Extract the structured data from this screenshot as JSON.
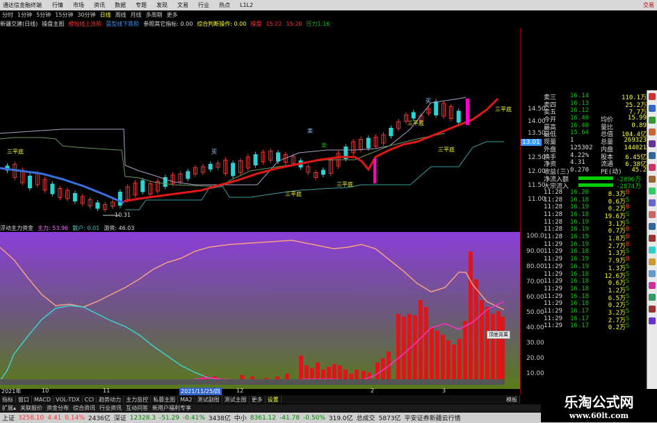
{
  "app": {
    "title": "通达信金融终端",
    "menus": [
      "行情",
      "市场",
      "资讯",
      "数据",
      "专题",
      "发现",
      "文易",
      "行业",
      "热点",
      "L1L2"
    ],
    "trade_label": "交易"
  },
  "periods": [
    "分时",
    "1分钟",
    "5分钟",
    "15分钟",
    "30分钟",
    "日线",
    "周线",
    "月线",
    "多周期",
    "更多"
  ],
  "periods_selected": 5,
  "indicator_line": {
    "main": "新疆交建(日线)",
    "n1": "操盘主图",
    "n2": "橙短线上涨阶",
    "n3": "蓝型线下跌阶",
    "n4": "参照其它指标: 0.00",
    "n5": "综合判断操作: 0.00",
    "n6": "操盘",
    "n7": "15:22",
    "n8": "15:20",
    "n9": "压力1:16"
  },
  "annotations": {
    "a1": "三平底",
    "a2": "三平底",
    "a3": "三平底",
    "a4": "三平底",
    "a5": "三平底",
    "a6": "三平底",
    "low": "10.31",
    "t1": "买",
    "t2": "卖",
    "t3": "买",
    "t4": "卖"
  },
  "yaxis_top": [
    "14.50",
    "14.00",
    "13.50",
    "13.01",
    "12.50",
    "12.00",
    "11.50",
    "11.00"
  ],
  "quote": {
    "rows": [
      {
        "k": "卖三",
        "v": "16.14",
        "r": "110.1万"
      },
      {
        "k": "卖四",
        "v": "16.13",
        "r": "25.2万"
      },
      {
        "k": "卖五",
        "v": "16.12",
        "r": "7.7万"
      },
      {
        "k": "今开",
        "v": "16.40",
        "k2": "均价",
        "r": "15.99"
      },
      {
        "k": "最高",
        "v": "16.40",
        "k2": "量比",
        "r": "0.89"
      },
      {
        "k": "最低",
        "v": "15.64",
        "k2": "总值",
        "r": "104.4亿"
      },
      {
        "k": "现量",
        "v": "1",
        "k2": "总量",
        "r": "269323"
      },
      {
        "k": "外盘",
        "v": "125302",
        "k2": "内盘",
        "r": "144021"
      },
      {
        "k": "换手",
        "v": "4.22%",
        "k2": "股本",
        "r": "6.45亿"
      },
      {
        "k": "净资",
        "v": "4.31",
        "k2": "流通",
        "r": "6.38亿"
      },
      {
        "k": "收益(三)",
        "v": "0.270",
        "k2": "PE(动)",
        "r": "45.2"
      }
    ],
    "flows": [
      {
        "k": "净流入额",
        "r": "-2896万"
      },
      {
        "k": "大宗流入",
        "r": "-2874万"
      }
    ],
    "ticks": [
      {
        "t": "11:28",
        "p": "16.20",
        "v": "8.3万",
        "s": "B"
      },
      {
        "t": "11:28",
        "p": "16.18",
        "v": "0.6万",
        "s": "S"
      },
      {
        "t": "11:28",
        "p": "16.19",
        "v": "0.2万",
        "s": "B"
      },
      {
        "t": "11:28",
        "p": "16.18",
        "v": "19.6万",
        "s": "S"
      },
      {
        "t": "11:28",
        "p": "16.19",
        "v": "3.1万",
        "s": "S"
      },
      {
        "t": "11:28",
        "p": "16.19",
        "v": "0.7万",
        "s": "B"
      },
      {
        "t": "11:28",
        "p": "16.19",
        "v": "1.8万",
        "s": "B"
      },
      {
        "t": "11:29",
        "p": "16.19",
        "v": "2.7万",
        "s": "B"
      },
      {
        "t": "11:29",
        "p": "16.18",
        "v": "1.3万",
        "s": "S"
      },
      {
        "t": "11:29",
        "p": "16.19",
        "v": "7.9万",
        "s": "B"
      },
      {
        "t": "11:29",
        "p": "16.19",
        "v": "1.3万",
        "s": "S"
      },
      {
        "t": "11:29",
        "p": "16.18",
        "v": "12.6万",
        "s": "S"
      },
      {
        "t": "11:29",
        "p": "16.18",
        "v": "0.6万",
        "s": "S"
      },
      {
        "t": "11:29",
        "p": "16.18",
        "v": "1.2万",
        "s": "S"
      },
      {
        "t": "11:29",
        "p": "16.18",
        "v": "6.5万",
        "s": "S"
      },
      {
        "t": "11:29",
        "p": "16.18",
        "v": "0.2万",
        "s": "S"
      },
      {
        "t": "11:29",
        "p": "16.17",
        "v": "3.2万",
        "s": "S"
      },
      {
        "t": "11:29",
        "p": "16.17",
        "v": "2.7万",
        "s": "S"
      },
      {
        "t": "11:29",
        "p": "16.17",
        "v": "0.2万",
        "s": "S"
      }
    ]
  },
  "sub_title": {
    "name": "浮动主力资金",
    "main": "主力: 53.96",
    "retail": "散户: 0.01",
    "swim": "游资: 46.03"
  },
  "yaxis_bot": [
    "100.0",
    "90.00",
    "80.00",
    "70.00",
    "60.00",
    "50.00",
    "40.00",
    "30.00",
    "20.00",
    "10.00"
  ],
  "date_axis": [
    "2021年",
    "10",
    "11",
    "2021/11/25/四",
    "12",
    "2",
    "3"
  ],
  "tooltip": "顶底背离",
  "tabs": [
    "指标",
    "窗口",
    "MACD",
    "VOL-TDX",
    "CCI",
    "趋势动力",
    "主力监控",
    "私募主图",
    "MA2",
    "测试副图",
    "测试主图",
    "更多",
    "设置"
  ],
  "tabs_selected": 12,
  "tabs_right": "模板",
  "tabs2": [
    "扩展▴",
    "关联报价",
    "资金分布",
    "综合资讯",
    "行业资讯",
    "互动问答",
    "新用户福利专享"
  ],
  "status": {
    "sh_label": "上证",
    "sh": "3258.10",
    "sh_chg": "4.41",
    "sh_pct": "0.14%",
    "sh_amt": "2436亿",
    "sz_label": "深证",
    "sz": "12328.3",
    "sz_chg": "-51.29",
    "sz_pct": "-0.41%",
    "sz_amt": "3438亿",
    "zx_label": "中小",
    "zx": "8361.12",
    "zx_chg": "-41.78",
    "zx_pct": "-0.50%",
    "zx_amt": "319.0亿",
    "tot_label": "总成交",
    "tot": "5873亿",
    "broker": "平安证券新疆云行情"
  },
  "watermark": {
    "line1": "乐淘公式网",
    "line2": "www.60lt.com"
  },
  "chart_data": {
    "type": "candlestick",
    "x_range": [
      "2021-09",
      "2022-03"
    ],
    "y_range": [
      11.0,
      14.5
    ],
    "sub_type": "bar+line",
    "sub_range": [
      0,
      100
    ],
    "sub_series": [
      "主力",
      "散户",
      "游资"
    ]
  }
}
